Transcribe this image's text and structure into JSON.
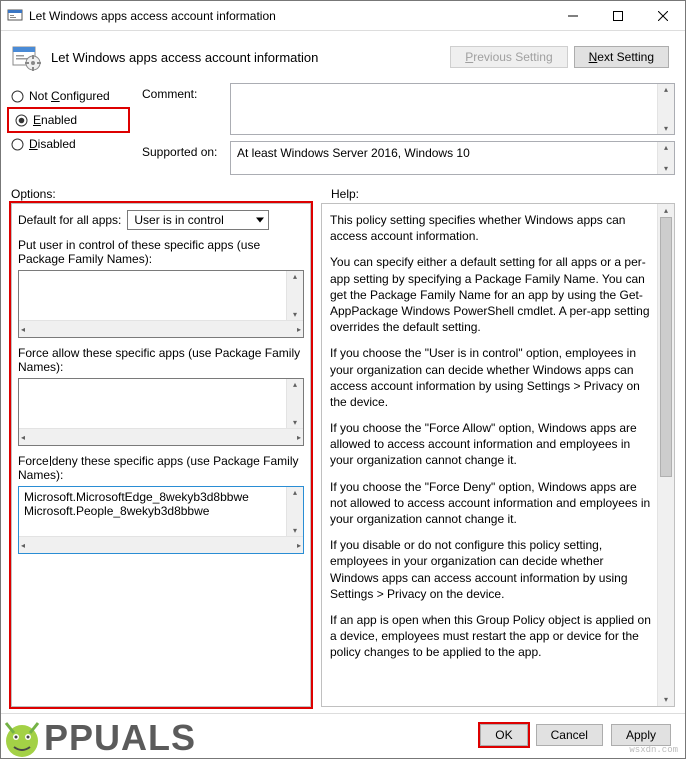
{
  "window": {
    "title": "Let Windows apps access account information"
  },
  "header": {
    "title": "Let Windows apps access account information"
  },
  "nav": {
    "prev": "Previous Setting",
    "next": "Next Setting"
  },
  "radios": {
    "not_configured": "Not Configured",
    "enabled": "Enabled",
    "disabled": "Disabled",
    "selected": "enabled"
  },
  "fields": {
    "comment_label": "Comment:",
    "comment_value": "",
    "supported_label": "Supported on:",
    "supported_value": "At least Windows Server 2016, Windows 10"
  },
  "labels": {
    "options": "Options:",
    "help": "Help:"
  },
  "options": {
    "default_label": "Default for all apps:",
    "default_value": "User is in control",
    "put_user_label": "Put user in control of these specific apps (use Package Family Names):",
    "put_user_value": "",
    "allow_label": "Force allow these specific apps (use Package Family Names):",
    "allow_value": "",
    "deny_label": "Force deny these specific apps (use Package Family Names):",
    "deny_value": "Microsoft.MicrosoftEdge_8wekyb3d8bbwe\nMicrosoft.People_8wekyb3d8bbwe"
  },
  "help": {
    "p1": "This policy setting specifies whether Windows apps can access account information.",
    "p2": "You can specify either a default setting for all apps or a per-app setting by specifying a Package Family Name. You can get the Package Family Name for an app by using the Get-AppPackage Windows PowerShell cmdlet. A per-app setting overrides the default setting.",
    "p3": "If you choose the \"User is in control\" option, employees in your organization can decide whether Windows apps can access account information by using Settings > Privacy on the device.",
    "p4": "If you choose the \"Force Allow\" option, Windows apps are allowed to access account information and employees in your organization cannot change it.",
    "p5": "If you choose the \"Force Deny\" option, Windows apps are not allowed to access account information and employees in your organization cannot change it.",
    "p6": "If you disable or do not configure this policy setting, employees in your organization can decide whether Windows apps can access account information by using Settings > Privacy on the device.",
    "p7": "If an app is open when this Group Policy object is applied on a device, employees must restart the app or device for the policy changes to be applied to the app."
  },
  "footer": {
    "ok": "OK",
    "cancel": "Cancel",
    "apply": "Apply"
  },
  "watermark": {
    "brand": "PPUALS",
    "site": "wsxdn.com"
  }
}
